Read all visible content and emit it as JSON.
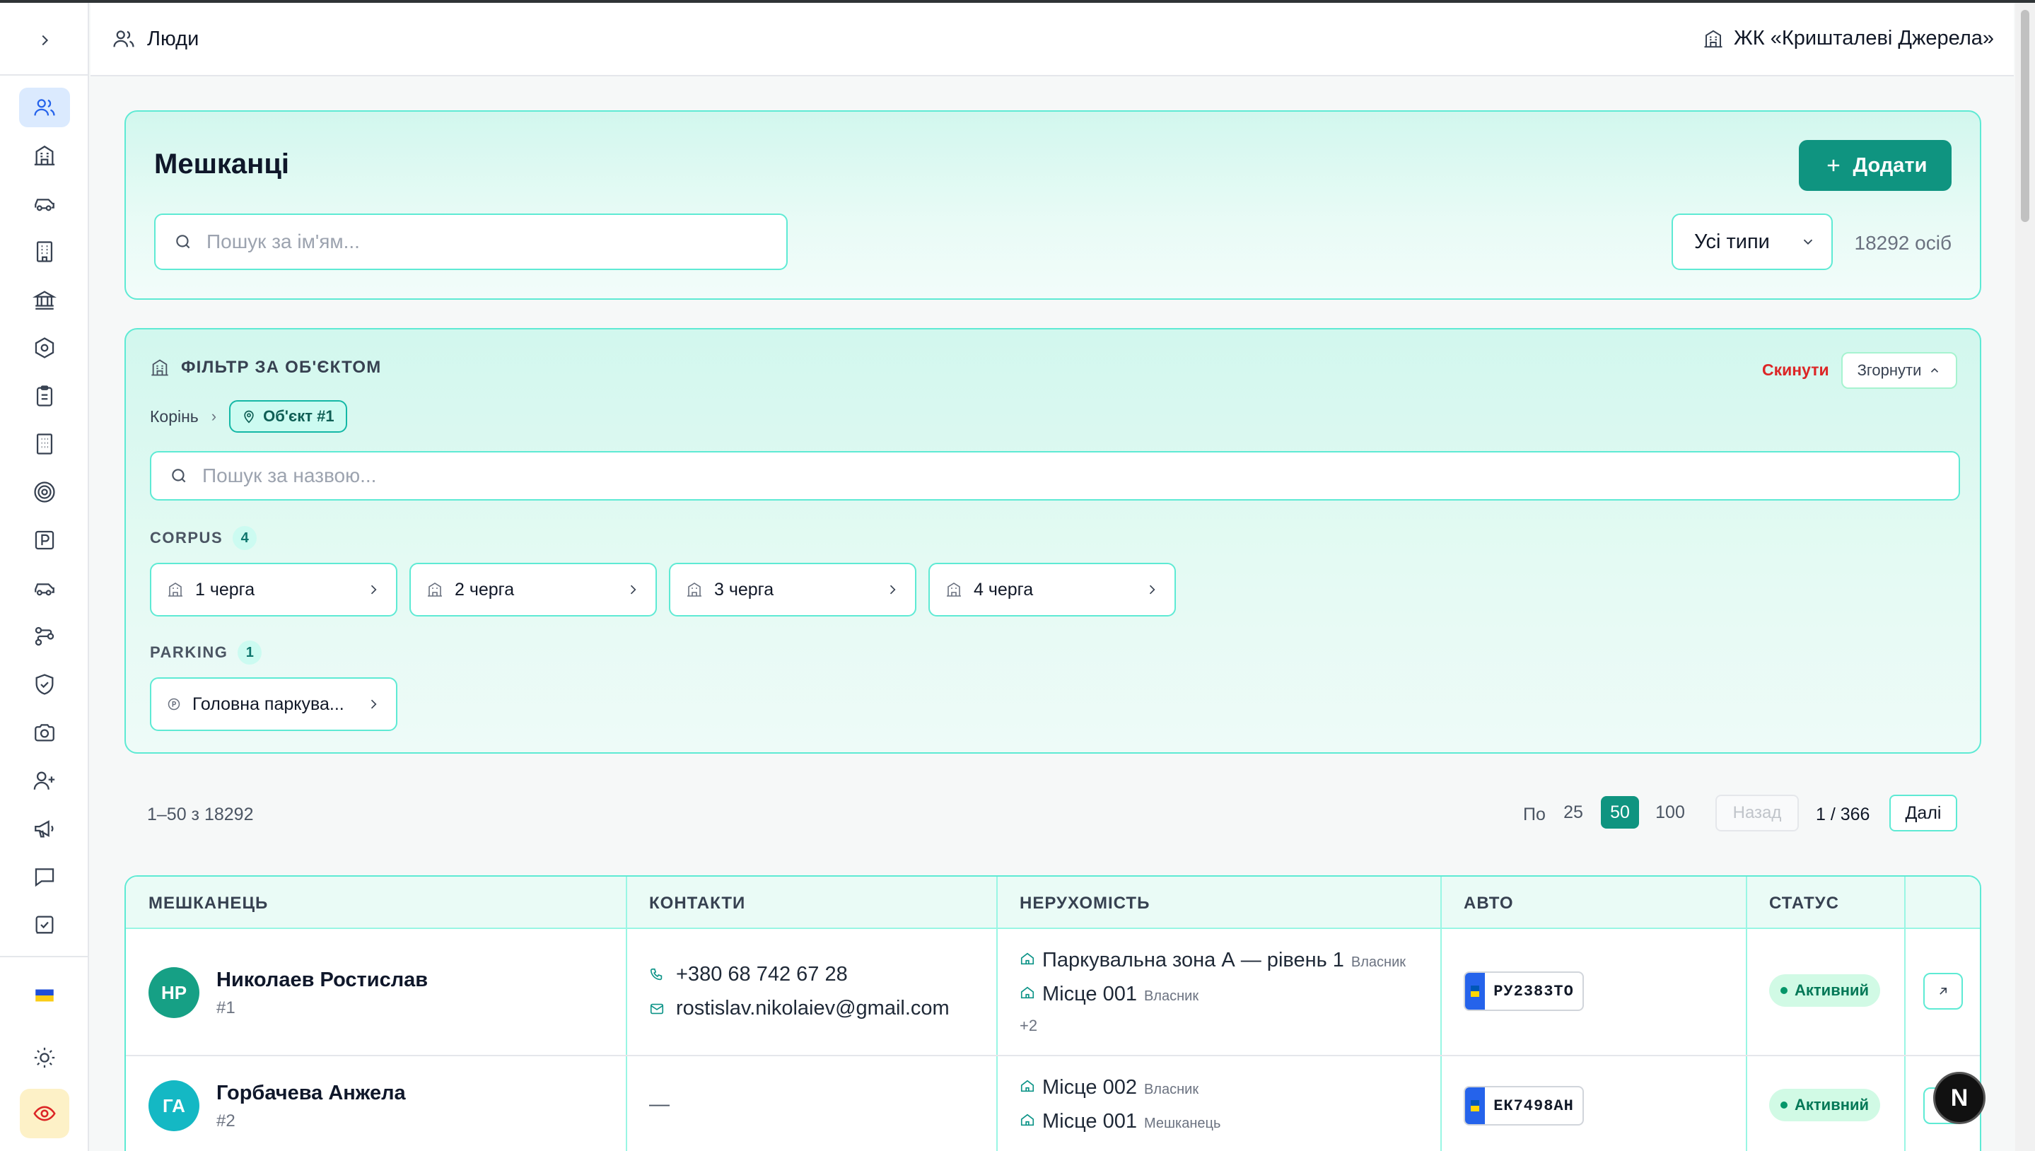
{
  "header": {
    "section_title": "Люди",
    "complex_name": "ЖК «Кришталеві Джерела»"
  },
  "sidebar": {
    "icons": [
      "users-icon",
      "building-icon",
      "car-icon",
      "office-icon",
      "bank-icon",
      "hexagon-icon",
      "clipboard-icon",
      "apartment-icon",
      "target-icon",
      "parking-icon",
      "car-alt-icon",
      "route-icon",
      "shield-icon",
      "camera-icon",
      "user-plus-icon",
      "megaphone-icon",
      "message-icon",
      "task-icon"
    ],
    "bottom": [
      "flag-ua-icon",
      "sun-icon",
      "eye-icon"
    ]
  },
  "residents_panel": {
    "title": "Мешканці",
    "add_label": "Додати",
    "search_placeholder": "Пошук за ім'ям...",
    "type_filter_value": "Усі типи",
    "count_label": "18292 осіб"
  },
  "filter_panel": {
    "title": "ФІЛЬТР ЗА ОБ'ЄКТОМ",
    "reset_label": "Скинути",
    "collapse_label": "Згорнути",
    "breadcrumb_root": "Корінь",
    "breadcrumb_current": "Об'єкт #1",
    "search_placeholder": "Пошук за назвою...",
    "groups": [
      {
        "label": "CORPUS",
        "count": "4",
        "items": [
          "1 черга",
          "2 черга",
          "3 черга",
          "4 черга"
        ]
      },
      {
        "label": "PARKING",
        "count": "1",
        "items": [
          "Головна паркува..."
        ]
      }
    ]
  },
  "pagination": {
    "range_label": "1–50 з 18292",
    "per_page_label": "По",
    "options": [
      "25",
      "50",
      "100"
    ],
    "selected": "50",
    "prev_label": "Назад",
    "page_label": "1 / 366",
    "next_label": "Далі"
  },
  "table": {
    "columns": [
      "МЕШКАНЕЦЬ",
      "КОНТАКТИ",
      "НЕРУХОМІСТЬ",
      "АВТО",
      "СТАТУС"
    ],
    "rows": [
      {
        "initials": "НР",
        "avatar_color": "#16a085",
        "name": "Николаев Ростислав",
        "id": "#1",
        "phone": "+380 68 742 67 28",
        "email": "rostislav.nikolaiev@gmail.com",
        "properties": [
          {
            "name": "Паркувальна зона А — рівень 1",
            "role": "Власник"
          },
          {
            "name": "Місце 001",
            "role": "Власник"
          }
        ],
        "more": "+2",
        "plate": "РУ2383ТО",
        "status": "Активний"
      },
      {
        "initials": "ГА",
        "avatar_color": "#14b8c4",
        "name": "Горбачева Анжела",
        "id": "#2",
        "contact_empty": "—",
        "properties": [
          {
            "name": "Місце 002",
            "role": "Власник"
          },
          {
            "name": "Місце 001",
            "role": "Мешканець"
          }
        ],
        "plate": "ЕК7498АН",
        "status": "Активний"
      }
    ]
  },
  "dev_badge": "N"
}
